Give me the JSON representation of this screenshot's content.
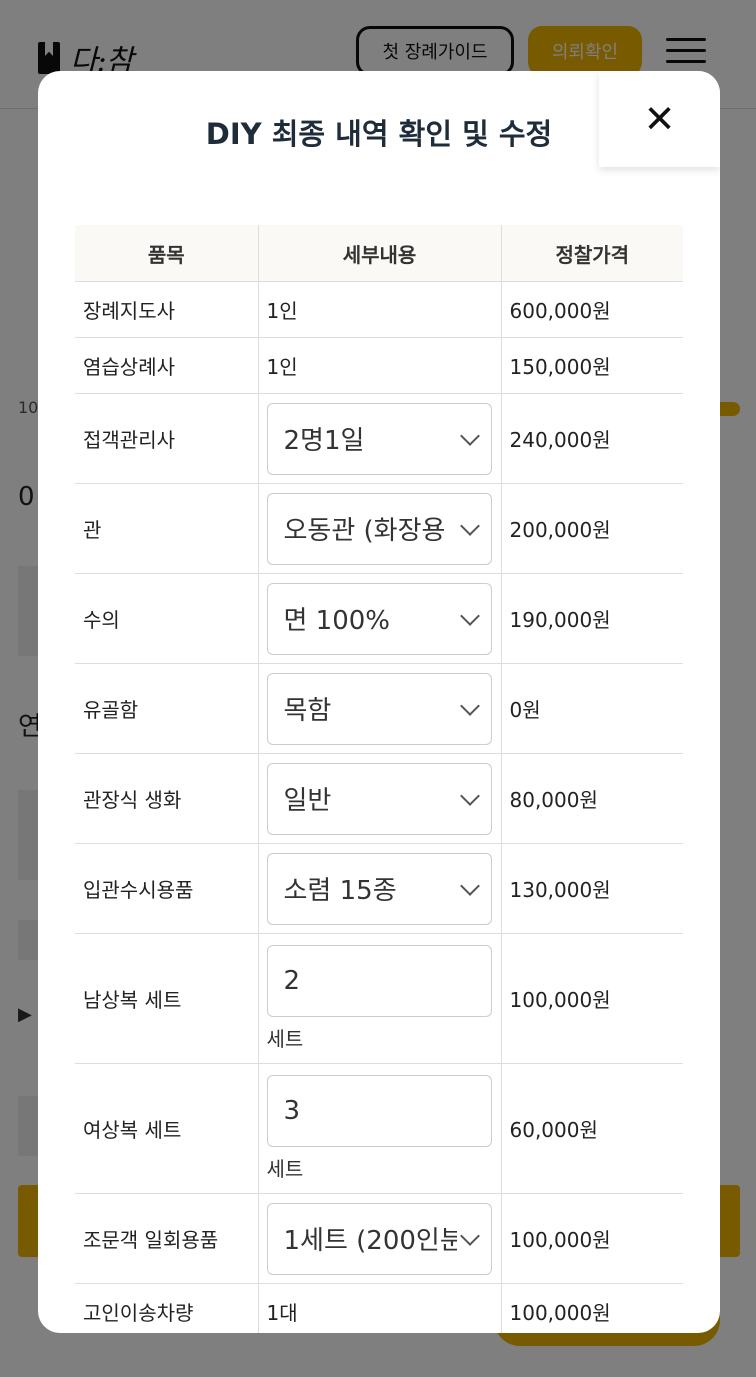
{
  "header": {
    "logo_text": "다:참",
    "guide_button": "첫 장례가이드",
    "confirm_button": "의뢰확인"
  },
  "background_fragments": {
    "a": "10",
    "b": "0",
    "c": "연",
    "d": "▶"
  },
  "modal": {
    "title": "DIY 최종 내역 확인 및 수정",
    "close_label": "✕",
    "columns": [
      "품목",
      "세부내용",
      "정찰가격"
    ],
    "rows": [
      {
        "item": "장례지도사",
        "detail": "1인",
        "price": "600,000원"
      },
      {
        "item": "염습상례사",
        "detail": "1인",
        "price": "150,000원"
      },
      {
        "item": "접객관리사",
        "detail": "2명1일",
        "price": "240,000원"
      },
      {
        "item": "관",
        "detail": "오동관 (화장용",
        "price": "200,000원"
      },
      {
        "item": "수의",
        "detail": "면 100%",
        "price": "190,000원"
      },
      {
        "item": "유골함",
        "detail": "목함",
        "price": "0원"
      },
      {
        "item": "관장식 생화",
        "detail": "일반",
        "price": "80,000원"
      },
      {
        "item": "입관수시용품",
        "detail": "소렴 15종",
        "price": "130,000원"
      },
      {
        "item": "남상복 세트",
        "detail": "2",
        "unit": "세트",
        "price": "100,000원"
      },
      {
        "item": "여상복 세트",
        "detail": "3",
        "unit": "세트",
        "price": "60,000원"
      },
      {
        "item": "조문객 일회용품",
        "detail": "1세트 (200인분",
        "price": "100,000원"
      },
      {
        "item": "고인이송차량",
        "detail": "1대",
        "price": "100,000원"
      }
    ]
  },
  "colors": {
    "accent": "#f0b400",
    "title": "#1f2c3a",
    "header_bg": "#faf9f5"
  }
}
